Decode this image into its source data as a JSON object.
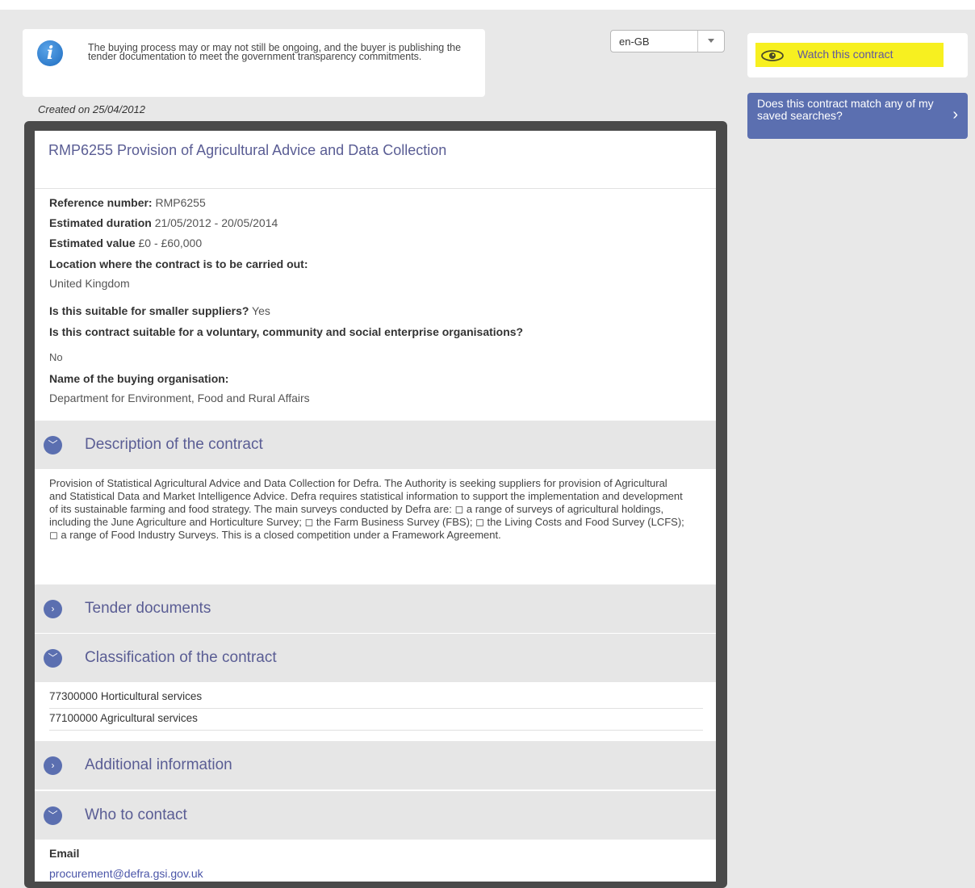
{
  "notice": {
    "text": "The buying process may or may not still be ongoing, and the buyer is publishing the tender documentation to meet the government transparency commitments."
  },
  "language": {
    "selected": "en-GB"
  },
  "watch": {
    "label": "Watch this contract"
  },
  "saved_search": {
    "label": "Does this contract match any of my saved searches?"
  },
  "created_on": "Created on 25/04/2012",
  "contract": {
    "title": "RMP6255 Provision of Agricultural Advice and Data Collection",
    "reference_label": "Reference number:",
    "reference_value": "RMP6255",
    "duration_label": "Estimated duration",
    "duration_value": "21/05/2012 - 20/05/2014",
    "value_label": "Estimated value",
    "value_value": "£0 - £60,000",
    "location_label": "Location where the contract is to be carried out:",
    "location_value": "United Kingdom",
    "smaller_label": "Is this suitable for smaller suppliers?",
    "smaller_value": "Yes",
    "vcse_label": "Is this contract suitable for a voluntary, community and social enterprise organisations?",
    "vcse_value": "No",
    "buyer_label": "Name of the buying organisation:",
    "buyer_value": "Department for Environment, Food and Rural Affairs"
  },
  "sections": {
    "description": {
      "title": "Description of the contract",
      "text": "Provision of Statistical Agricultural Advice and Data Collection for Defra. The Authority is seeking suppliers for provision of Agricultural and Statistical Data and Market Intelligence Advice. Defra requires statistical information to support the implementation and development of its sustainable farming and food strategy. The main surveys conducted by Defra are: ◻ a range of surveys of agricultural holdings, including the June Agriculture and Horticulture Survey; ◻ the Farm Business Survey (FBS); ◻ the Living Costs and Food Survey (LCFS); ◻ a range of Food Industry Surveys. This is a closed competition under a Framework Agreement."
    },
    "tender": {
      "title": "Tender documents"
    },
    "classification": {
      "title": "Classification of the contract",
      "items": [
        {
          "code": "77300000",
          "name": "Horticultural services"
        },
        {
          "code": "77100000",
          "name": "Agricultural services"
        }
      ]
    },
    "additional": {
      "title": "Additional information"
    },
    "contact": {
      "title": "Who to contact",
      "email_label": "Email",
      "email_value": "procurement@defra.gsi.gov.uk"
    }
  },
  "icons": {
    "info": "info-icon",
    "eye": "eye-icon",
    "chevron_right": "chevron-right-icon",
    "chevron_down": "chevron-down-icon",
    "dropdown_arrow": "dropdown-arrow-icon"
  },
  "colors": {
    "accent": "#5b6fb0",
    "title": "#5a5d94",
    "highlight": "#f7f020",
    "frame": "#4a4a4a"
  }
}
